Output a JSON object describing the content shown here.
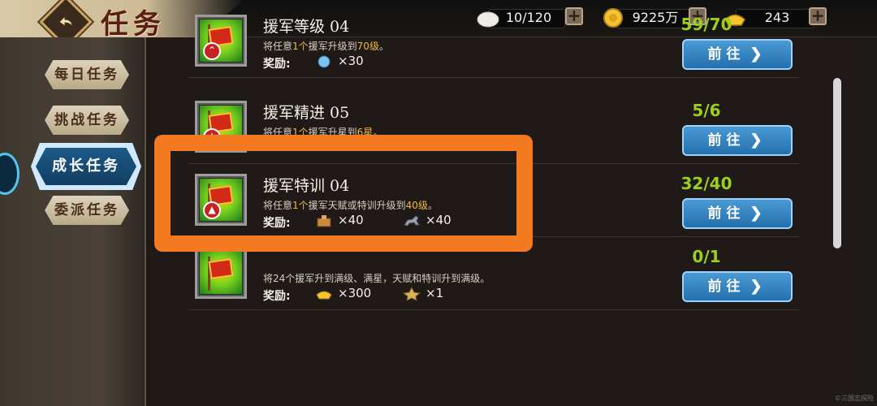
{
  "header": {
    "title": "任务",
    "resources": [
      {
        "name": "steamed-bun",
        "value": "10/120",
        "color": "#e8e4dc"
      },
      {
        "name": "gold-coin",
        "value": "9225万",
        "color": "#f5c230"
      },
      {
        "name": "ingot",
        "value": "243",
        "color": "#f5c230"
      }
    ]
  },
  "sidebar": {
    "tabs": [
      {
        "label": "每日任务",
        "active": false
      },
      {
        "label": "挑战任务",
        "active": false
      },
      {
        "label": "成长任务",
        "active": true
      },
      {
        "label": "委派任务",
        "active": false
      }
    ]
  },
  "tasks": [
    {
      "name": "援军等级 04",
      "desc_parts": [
        "将任意",
        "1个",
        "援军升级到",
        "70级",
        "。"
      ],
      "reward_label": "奖励:",
      "rewards": [
        {
          "icon": "blue-orb-icon",
          "qty": "×30"
        }
      ],
      "progress": "59/70",
      "go_label": "前往"
    },
    {
      "name": "援军精进 05",
      "desc_parts": [
        "将任意",
        "1个",
        "援军升星到",
        "6星",
        "。"
      ],
      "reward_label": "奖励:",
      "rewards": [],
      "progress": "5/6",
      "go_label": "前往"
    },
    {
      "name": "援军特训 04",
      "desc_parts": [
        "将任意",
        "1个",
        "援军天赋或特训升级到",
        "40级",
        "。"
      ],
      "reward_label": "奖励:",
      "rewards": [
        {
          "icon": "crate-icon",
          "qty": "×40"
        },
        {
          "icon": "horse-icon",
          "qty": "×40"
        }
      ],
      "progress": "32/40",
      "go_label": "前往"
    },
    {
      "name": "",
      "desc_parts": [
        "将24个援军升到满级、满星，天赋和特训升到满级。",
        "",
        "",
        "",
        ""
      ],
      "reward_label": "奖励:",
      "rewards": [
        {
          "icon": "ingot-icon",
          "qty": "×300"
        },
        {
          "icon": "medal-icon",
          "qty": "×1"
        }
      ],
      "progress": "0/1",
      "go_label": "前往"
    }
  ],
  "watermark": "©三国志探险"
}
